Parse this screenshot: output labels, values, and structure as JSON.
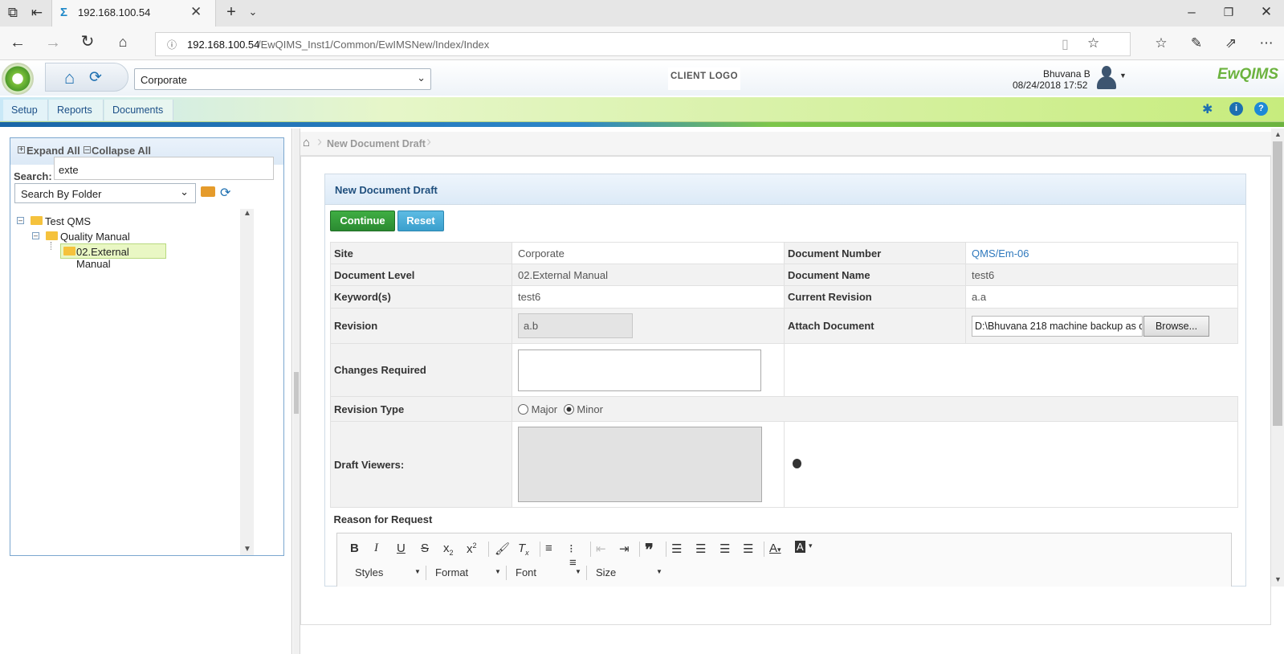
{
  "browser": {
    "tab_title": "192.168.100.54",
    "url_host": "192.168.100.54",
    "url_path": "/EwQIMS_Inst1/Common/EwIMSNew/Index/Index"
  },
  "header": {
    "site_select": "Corporate",
    "client_logo": "CLIENT LOGO",
    "user_name": "Bhuvana B",
    "datetime": "08/24/2018 17:52",
    "brand": "EwQIMS"
  },
  "nav": {
    "items": [
      {
        "label": "Setup"
      },
      {
        "label": "Reports"
      },
      {
        "label": "Documents"
      }
    ]
  },
  "tree": {
    "expand_all": "Expand All",
    "collapse_all": "Collapse All",
    "search_label": "Search:",
    "search_value": "exte",
    "search_mode": "Search By Folder",
    "nodes": [
      {
        "label": "Test QMS"
      },
      {
        "label": "Quality Manual"
      },
      {
        "label": "02.External Manual"
      }
    ]
  },
  "breadcrumb": {
    "current": "New Document Draft"
  },
  "form": {
    "title": "New Document Draft",
    "continue_label": "Continue",
    "reset_label": "Reset",
    "site_label": "Site",
    "site_value": "Corporate",
    "doc_number_label": "Document Number",
    "doc_number_value": "QMS/Em-06",
    "doc_level_label": "Document Level",
    "doc_level_value": "02.External Manual",
    "doc_name_label": "Document Name",
    "doc_name_value": "test6",
    "keywords_label": "Keyword(s)",
    "keywords_value": "test6",
    "current_rev_label": "Current Revision",
    "current_rev_value": "a.a",
    "revision_label": "Revision",
    "revision_value": "a.b",
    "attach_label": "Attach Document",
    "attach_value": "D:\\Bhuvana 218 machine backup as o",
    "browse_label": "Browse...",
    "changes_label": "Changes Required",
    "rev_type_label": "Revision Type",
    "rev_type_major": "Major",
    "rev_type_minor": "Minor",
    "draft_viewers_label": "Draft Viewers:",
    "reason_label": "Reason for Request"
  },
  "editor": {
    "styles": "Styles",
    "format": "Format",
    "font": "Font",
    "size": "Size"
  }
}
